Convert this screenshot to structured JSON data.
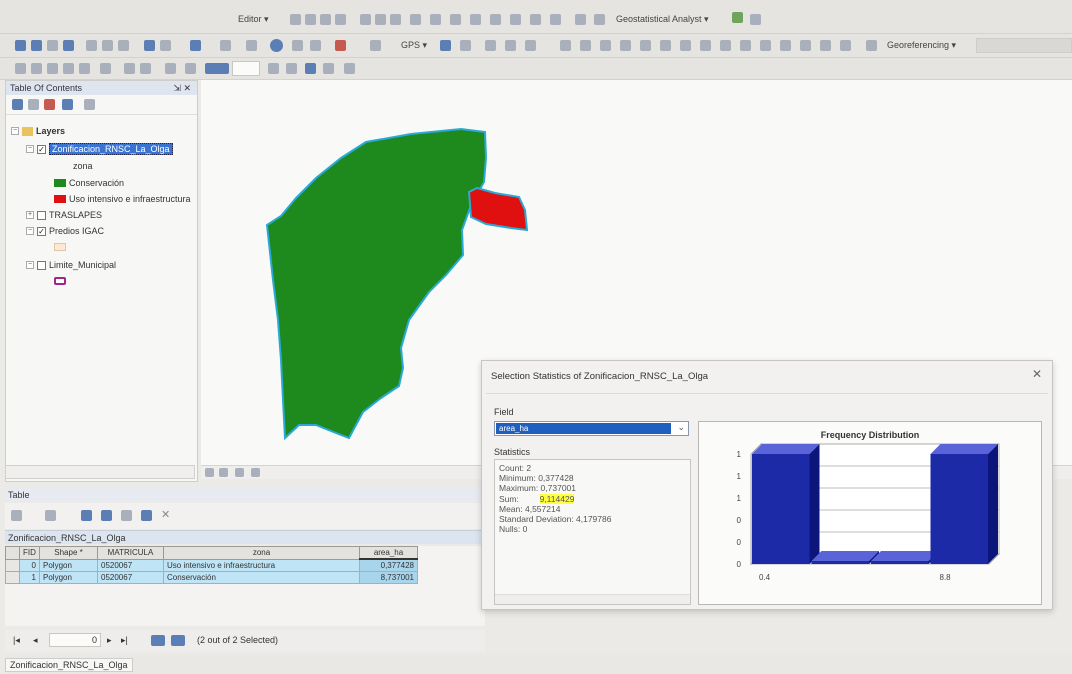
{
  "toolbar": {
    "editor_label": "Editor ▾",
    "geostat_label": "Geostatistical Analyst ▾",
    "gps_label": "GPS ▾",
    "georef_label": "Georeferencing ▾"
  },
  "toc": {
    "title": "Table Of Contents",
    "pin_close": "⇲ ✕",
    "layers_label": "Layers",
    "layer1_name": "Zonificacion_RNSC_La_Olga",
    "layer1_field": "zona",
    "legend1_label": "Conservación",
    "legend2_label": "Uso intensivo e infraestructura",
    "layer2_name": "TRASLAPES",
    "layer3_name": "Predios IGAC",
    "layer4_name": "Limite_Municipal"
  },
  "table": {
    "window_title": "Table",
    "table_name": "Zonificacion_RNSC_La_Olga",
    "columns": [
      "FID",
      "Shape *",
      "MATRICULA",
      "zona",
      "area_ha"
    ],
    "rows": [
      [
        "0",
        "Polygon",
        "0520067",
        "Uso intensivo e infraestructura",
        "0,377428"
      ],
      [
        "1",
        "Polygon",
        "0520067",
        "Conservación",
        "8,737001"
      ]
    ],
    "nav_counter": "0",
    "selection_status": "(2 out of 2 Selected)",
    "tab_label": "Zonificacion_RNSC_La_Olga"
  },
  "dialog": {
    "title": "Selection Statistics of Zonificacion_RNSC_La_Olga",
    "close_label": "✕",
    "field_label": "Field",
    "field_value": "area_ha",
    "statistics_label": "Statistics",
    "stats": {
      "count": "Count:    2",
      "minimum": "Minimum: 0,377428",
      "maximum": "Maximum: 0,737001",
      "sum_label": "Sum:",
      "sum_value": "9,114429",
      "mean": "Mean:     4,557214",
      "std": "Standard Deviation: 4,179786",
      "nulls": "Nulls:    0"
    }
  },
  "chart_data": {
    "type": "bar",
    "title": "Frequency Distribution",
    "categories": [
      "0.4",
      "",
      "",
      "8.8"
    ],
    "x_tick_labels": [
      "0.4",
      "8.8"
    ],
    "y_tick_labels": [
      "0",
      "0",
      "0",
      "1",
      "1",
      "1"
    ],
    "values": [
      1,
      0,
      0,
      1
    ],
    "ylim": [
      0,
      1
    ],
    "bar_color": "#1c2aa8",
    "grid": true
  },
  "map": {
    "conservacion_color": "#1e8a1e",
    "uso_color": "#e01010",
    "outline_color": "#2aa9d6"
  }
}
